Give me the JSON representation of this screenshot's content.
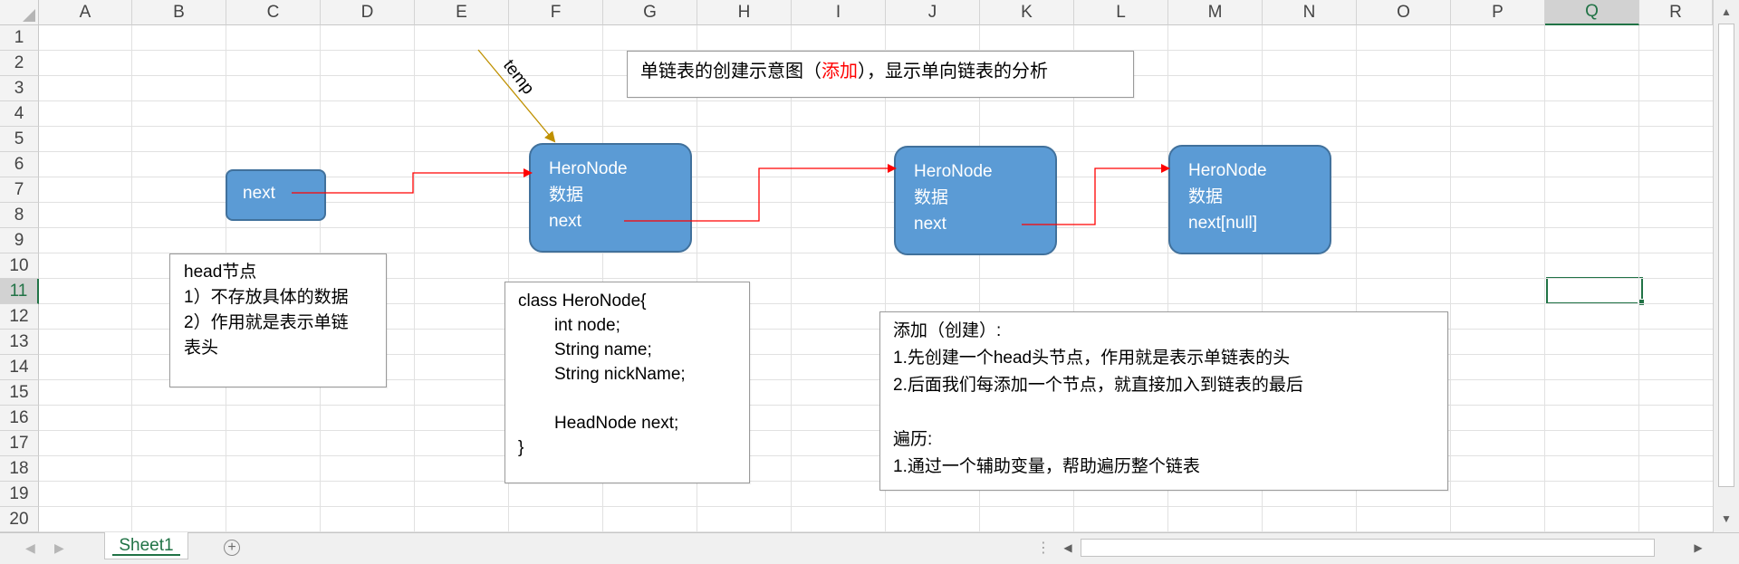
{
  "spreadsheet": {
    "columns": [
      "A",
      "B",
      "C",
      "D",
      "E",
      "F",
      "G",
      "H",
      "I",
      "J",
      "K",
      "L",
      "M",
      "N",
      "O",
      "P",
      "Q",
      "R"
    ],
    "rows": [
      "1",
      "2",
      "3",
      "4",
      "5",
      "6",
      "7",
      "8",
      "9",
      "10",
      "11",
      "12",
      "13",
      "14",
      "15",
      "16",
      "17",
      "18",
      "19",
      "20"
    ],
    "selected_column": "Q",
    "selected_row": "11",
    "active_cell": "Q11"
  },
  "title_box": {
    "prefix": "单链表的创建示意图（",
    "highlight": "添加",
    "suffix": "），显示单向链表的分析",
    "highlight_color": "#ff0000"
  },
  "temp_label": "temp",
  "head_node": {
    "label": "next"
  },
  "nodes": [
    {
      "line1": "HeroNode",
      "line2": "数据",
      "line3": "next"
    },
    {
      "line1": "HeroNode",
      "line2": "数据",
      "line3": "next"
    },
    {
      "line1": "HeroNode",
      "line2": "数据",
      "line3": "next[null]"
    }
  ],
  "head_note": {
    "lines": [
      "head节点",
      "1）不存放具体的数据",
      "2）作用就是表示单链",
      "表头"
    ]
  },
  "class_box": {
    "lines": [
      "class HeroNode{",
      "int node;",
      "String name;",
      "String nickName;",
      "",
      "HeadNode next;",
      "}"
    ]
  },
  "add_note": {
    "lines": [
      "添加（创建）:",
      "1.先创建一个head头节点，作用就是表示单链表的头",
      "2.后面我们每添加一个节点，就直接加入到链表的最后",
      "",
      "遍历:",
      "1.通过一个辅助变量，帮助遍历整个链表"
    ]
  },
  "sheet_tabs": [
    "Sheet1"
  ],
  "colors": {
    "node_fill": "#5b9bd5",
    "node_border": "#41719c",
    "arrow_red": "#ff0000",
    "temp_arrow": "#bf9000",
    "excel_green": "#217346"
  },
  "icons": {
    "add_sheet": "plus-circle-icon",
    "scroll_up": "triangle-up-icon",
    "scroll_down": "triangle-down-icon",
    "scroll_left": "triangle-left-icon",
    "scroll_right": "triangle-right-icon"
  }
}
